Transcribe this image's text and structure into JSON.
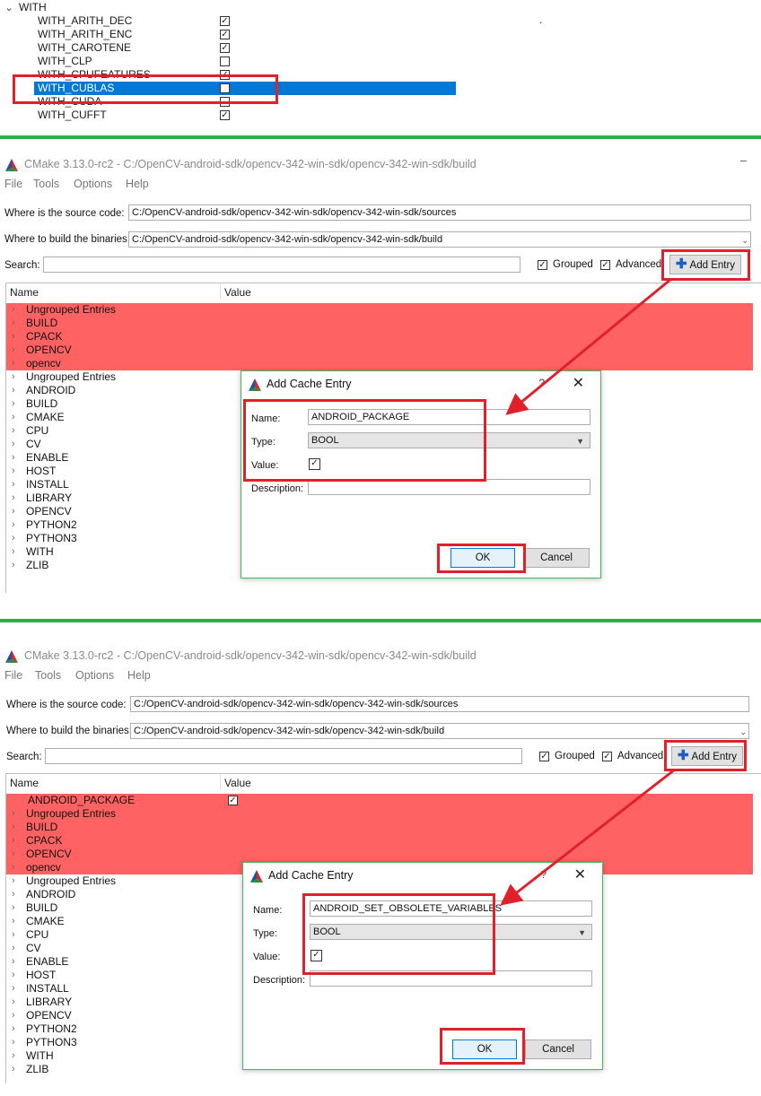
{
  "section1": {
    "group_label": "WITH",
    "rows": [
      {
        "label": "WITH_ARITH_DEC",
        "checked": true
      },
      {
        "label": "WITH_ARITH_ENC",
        "checked": true
      },
      {
        "label": "WITH_CAROTENE",
        "checked": true
      },
      {
        "label": "WITH_CLP",
        "checked": false
      },
      {
        "label": "WITH_CPUFEATURES",
        "checked": true
      },
      {
        "label": "WITH_CUBLAS",
        "checked": false,
        "selected": true
      },
      {
        "label": "WITH_CUDA",
        "checked": false
      },
      {
        "label": "WITH_CUFFT",
        "checked": true
      }
    ],
    "stray_dot": "."
  },
  "colors": {
    "highlight_red": "#ff6262",
    "annotation_red": "#e0202a",
    "separator_green": "#2eae4a",
    "selection_blue": "#0078d7"
  },
  "window1": {
    "title": "CMake 3.13.0-rc2 - C:/OpenCV-android-sdk/opencv-342-win-sdk/opencv-342-win-sdk/build",
    "menu": [
      "File",
      "Tools",
      "Options",
      "Help"
    ],
    "source_label": "Where is the source code:",
    "source_value": "C:/OpenCV-android-sdk/opencv-342-win-sdk/opencv-342-win-sdk/sources",
    "build_label": "Where to build the binaries:",
    "build_value": "C:/OpenCV-android-sdk/opencv-342-win-sdk/opencv-342-win-sdk/build",
    "search_label": "Search:",
    "search_value": "",
    "grouped_label": "Grouped",
    "advanced_label": "Advanced",
    "add_entry_label": "Add Entry",
    "col_name": "Name",
    "col_value": "Value",
    "red_rows": [
      "Ungrouped Entries",
      "BUILD",
      "CPACK",
      "OPENCV",
      "opencv"
    ],
    "rows": [
      "Ungrouped Entries",
      "ANDROID",
      "BUILD",
      "CMAKE",
      "CPU",
      "CV",
      "ENABLE",
      "HOST",
      "INSTALL",
      "LIBRARY",
      "OPENCV",
      "PYTHON2",
      "PYTHON3",
      "WITH",
      "ZLIB"
    ],
    "dialog": {
      "title": "Add Cache Entry",
      "help": "?",
      "name_label": "Name:",
      "name_value": "ANDROID_PACKAGE",
      "type_label": "Type:",
      "type_value": "BOOL",
      "value_label": "Value:",
      "value_checked": true,
      "desc_label": "Description:",
      "desc_value": "",
      "ok_label": "OK",
      "cancel_label": "Cancel"
    }
  },
  "window2": {
    "title": "CMake 3.13.0-rc2 - C:/OpenCV-android-sdk/opencv-342-win-sdk/opencv-342-win-sdk/build",
    "menu": [
      "File",
      "Tools",
      "Options",
      "Help"
    ],
    "source_label": "Where is the source code:",
    "source_value": "C:/OpenCV-android-sdk/opencv-342-win-sdk/opencv-342-win-sdk/sources",
    "build_label": "Where to build the binaries:",
    "build_value": "C:/OpenCV-android-sdk/opencv-342-win-sdk/opencv-342-win-sdk/build",
    "search_label": "Search:",
    "search_value": "",
    "grouped_label": "Grouped",
    "advanced_label": "Advanced",
    "add_entry_label": "Add Entry",
    "col_name": "Name",
    "col_value": "Value",
    "new_entry": {
      "name": "ANDROID_PACKAGE",
      "checked": true
    },
    "red_rows": [
      "Ungrouped Entries",
      "BUILD",
      "CPACK",
      "OPENCV",
      "opencv"
    ],
    "rows": [
      "Ungrouped Entries",
      "ANDROID",
      "BUILD",
      "CMAKE",
      "CPU",
      "CV",
      "ENABLE",
      "HOST",
      "INSTALL",
      "LIBRARY",
      "OPENCV",
      "PYTHON2",
      "PYTHON3",
      "WITH",
      "ZLIB"
    ],
    "dialog": {
      "title": "Add Cache Entry",
      "help": "?",
      "name_label": "Name:",
      "name_value": "ANDROID_SET_OBSOLETE_VARIABLES",
      "type_label": "Type:",
      "type_value": "BOOL",
      "value_label": "Value:",
      "value_checked": true,
      "desc_label": "Description:",
      "desc_value": "",
      "ok_label": "OK",
      "cancel_label": "Cancel"
    }
  },
  "icons": {
    "cmake_logo": "cmake-triangle-icon",
    "expand": "chevron-right-icon",
    "add": "plus-icon",
    "close": "close-icon",
    "combo": "chevron-down-icon"
  }
}
